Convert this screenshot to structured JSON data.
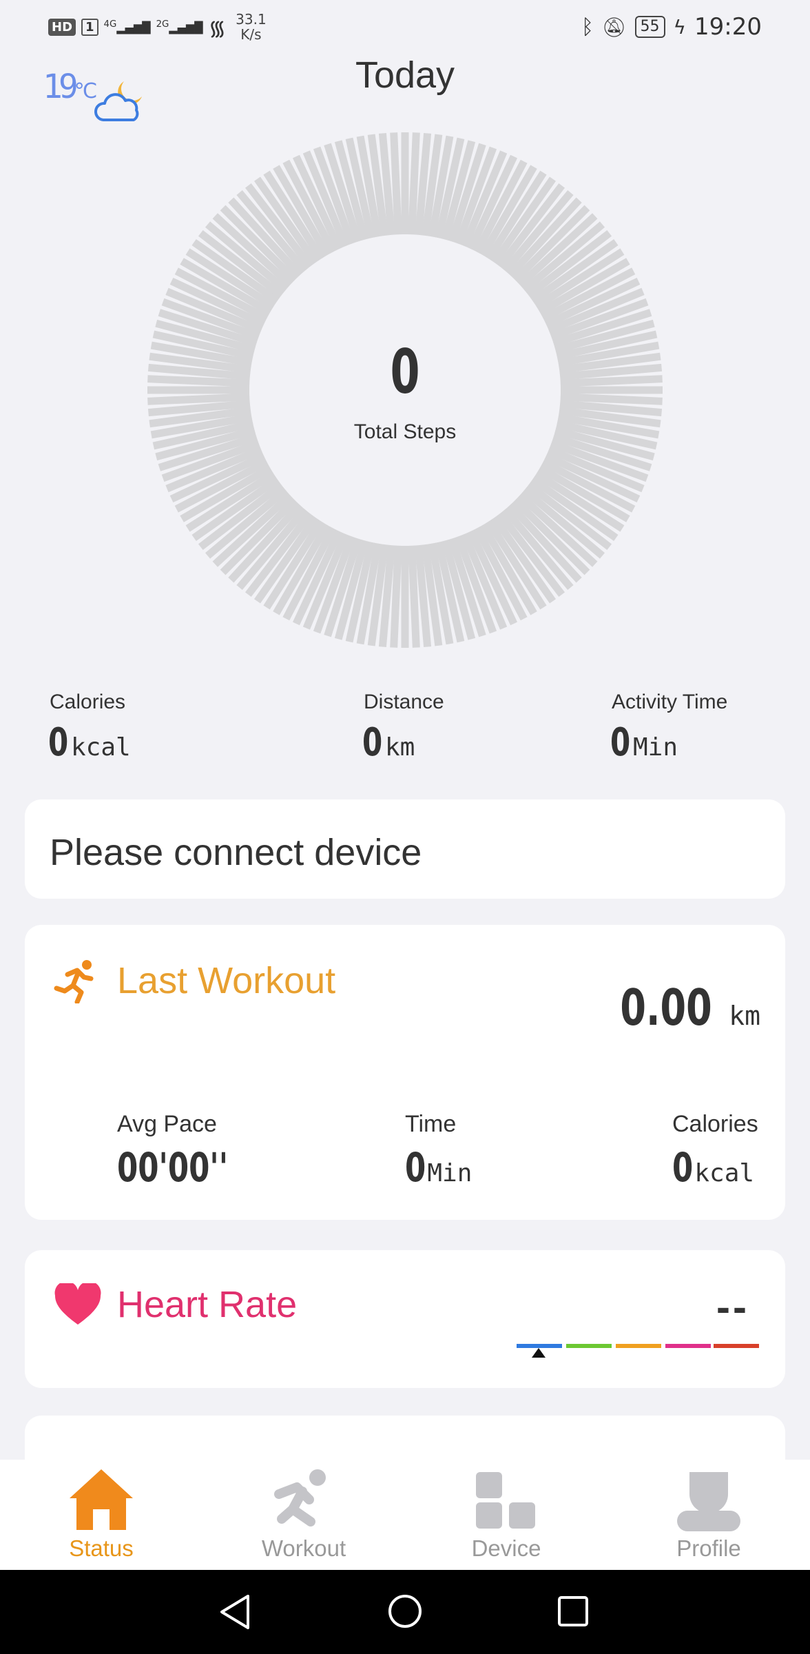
{
  "status_bar": {
    "hd": "HD",
    "sim": "1",
    "signal1": "4G",
    "signal2": "2G",
    "speed_value": "33.1",
    "speed_unit": "K/s",
    "battery": "55",
    "time": "19:20"
  },
  "weather": {
    "temp_value": "19",
    "temp_unit": "℃",
    "icon": "cloud-moon-icon"
  },
  "header": {
    "title": "Today"
  },
  "steps": {
    "value": "0",
    "label": "Total Steps"
  },
  "metrics": [
    {
      "label": "Calories",
      "value": "0",
      "unit": "kcal"
    },
    {
      "label": "Distance",
      "value": "0",
      "unit": "km"
    },
    {
      "label": "Activity Time",
      "value": "0",
      "unit": "Min"
    }
  ],
  "connect_card": {
    "text": "Please connect device"
  },
  "last_workout": {
    "title": "Last Workout",
    "distance": "0.00",
    "distance_unit": "km",
    "stats": [
      {
        "label": "Avg Pace",
        "value": "00'00''",
        "unit": ""
      },
      {
        "label": "Time",
        "value": "0",
        "unit": "Min"
      },
      {
        "label": "Calories",
        "value": "0",
        "unit": "kcal"
      }
    ]
  },
  "heart_rate": {
    "title": "Heart Rate",
    "value": "--",
    "zone_colors": [
      "#2f7ae0",
      "#6cc832",
      "#f0a020",
      "#e0308a",
      "#d8402a"
    ]
  },
  "tabs": [
    {
      "label": "Status",
      "icon": "home-icon",
      "active": true
    },
    {
      "label": "Workout",
      "icon": "running-icon",
      "active": false
    },
    {
      "label": "Device",
      "icon": "device-grid-icon",
      "active": false
    },
    {
      "label": "Profile",
      "icon": "person-icon",
      "active": false
    }
  ],
  "colors": {
    "accent": "#e8961a",
    "workout": "#e8a030",
    "heart": "#e0306e",
    "ring": "#d6d6d8"
  }
}
